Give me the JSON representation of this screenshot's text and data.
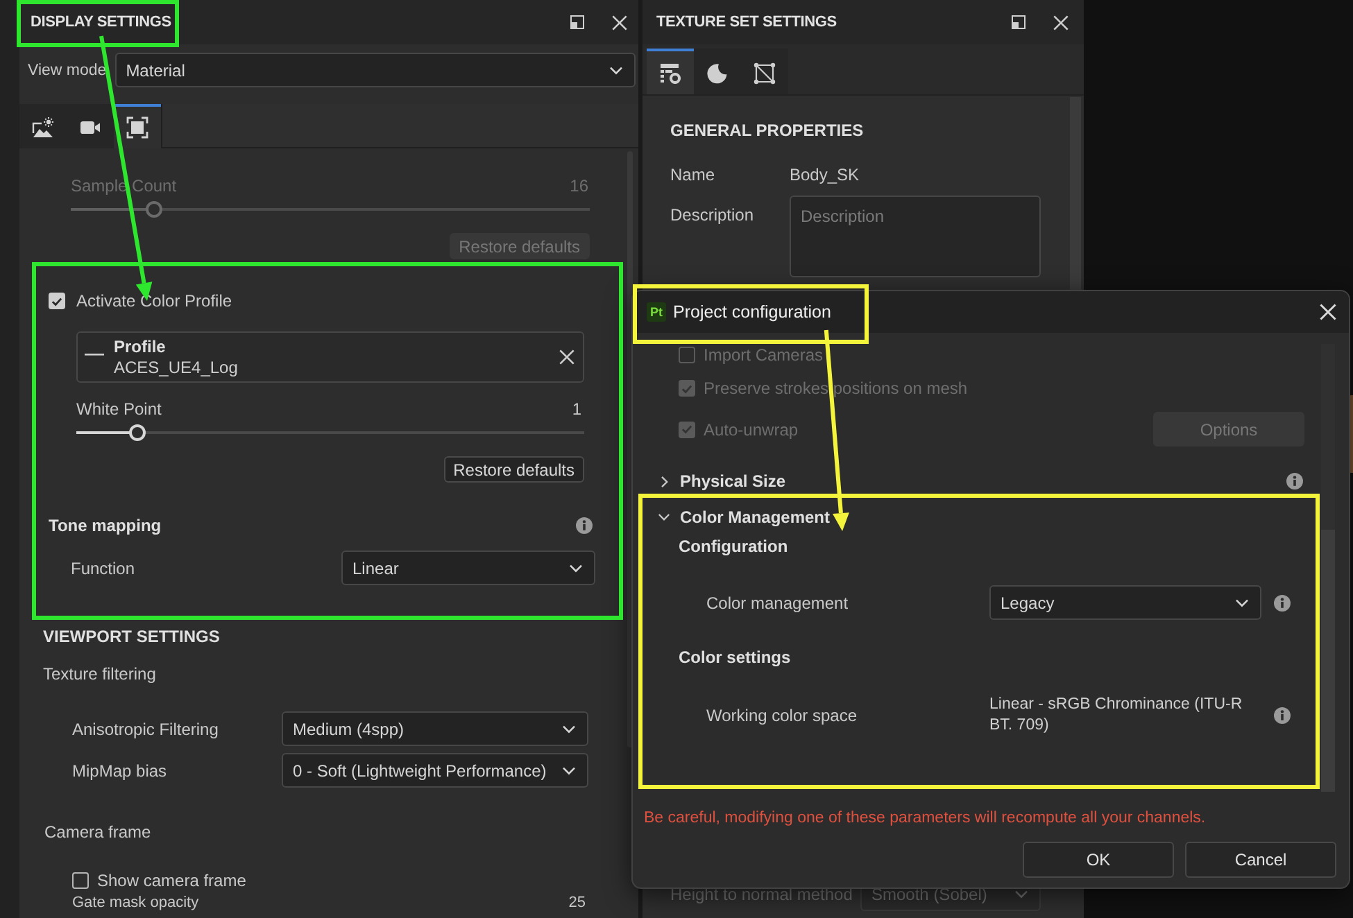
{
  "display_settings": {
    "title": "DISPLAY SETTINGS",
    "view_mode": {
      "label": "View mode",
      "value": "Material"
    },
    "tabs": [
      {
        "kind": "environment",
        "selected": false
      },
      {
        "kind": "camera",
        "selected": false
      },
      {
        "kind": "display",
        "selected": true
      }
    ],
    "sample_count": {
      "label": "Sample Count",
      "reading": "16",
      "level": 0.16,
      "disabled": true
    },
    "sample_restore": {
      "label": "Restore defaults",
      "disabled": true
    },
    "color_profile": {
      "label": "Activate Color Profile",
      "checked": true
    },
    "profile": {
      "title": "Profile",
      "value": "ACES_UE4_Log"
    },
    "white_point": {
      "label": "White Point",
      "reading": "1",
      "level": 0.12
    },
    "white_point_restore": {
      "label": "Restore defaults",
      "disabled": false
    },
    "tone_mapping": {
      "title": "Tone mapping",
      "function": {
        "label": "Function",
        "value": "Linear"
      }
    }
  },
  "viewport_settings": {
    "title": "VIEWPORT SETTINGS",
    "texture_filtering": {
      "title": "Texture filtering",
      "fields": [
        {
          "label": "Anisotropic Filtering",
          "value": "Medium (4spp)"
        },
        {
          "label": "MipMap bias",
          "value": "0 - Soft (Lightweight Performance)"
        }
      ]
    },
    "camera_frame": {
      "title": "Camera frame",
      "show_frame": {
        "label": "Show camera frame",
        "checked": false
      },
      "gate_mask_opacity": {
        "label": "Gate mask opacity",
        "reading": "25"
      }
    }
  },
  "texture_set_settings": {
    "title": "TEXTURE SET SETTINGS",
    "tabs": [
      {
        "kind": "properties",
        "selected": true
      },
      {
        "kind": "material",
        "selected": false
      },
      {
        "kind": "uv",
        "selected": false
      }
    ],
    "section_title": "GENERAL PROPERTIES",
    "name": {
      "label": "Name",
      "value": "Body_SK"
    },
    "description": {
      "label": "Description",
      "placeholder": "Description"
    },
    "height_to_normal": {
      "label": "Height to normal method",
      "value": "Smooth (Sobel)",
      "disabled": true
    }
  },
  "project_configuration": {
    "logo": "Pt",
    "title": "Project configuration",
    "options": [
      {
        "label": "Import Cameras",
        "checked": false,
        "disabled": true
      },
      {
        "label": "Preserve strokes positions on mesh",
        "checked": true,
        "disabled": true
      },
      {
        "label": "Auto-unwrap",
        "checked": true,
        "disabled": true
      }
    ],
    "options_button": {
      "label": "Options",
      "disabled": true
    },
    "sections": [
      {
        "title": "Physical Size",
        "expanded": false,
        "info": true
      },
      {
        "title": "Color Management",
        "expanded": true,
        "info": false,
        "groups": [
          {
            "title": "Configuration",
            "fields": [
              {
                "kind": "dropdown",
                "label": "Color management",
                "value": "Legacy"
              }
            ]
          },
          {
            "title": "Color settings",
            "fields": [
              {
                "kind": "text",
                "label": "Working color space",
                "value": "Linear - sRGB Chrominance (ITU-R BT. 709)"
              }
            ]
          }
        ]
      }
    ],
    "warning": "Be careful, modifying one of these parameters will recompute all your channels.",
    "buttons": [
      {
        "label": "OK"
      },
      {
        "label": "Cancel"
      }
    ]
  },
  "annotations": [
    {
      "kind": "box",
      "color": "#2ee62e"
    },
    {
      "kind": "arrow",
      "color": "#2ee62e"
    },
    {
      "kind": "box",
      "color": "#2ee62e"
    },
    {
      "kind": "box",
      "color": "#f4f43c"
    },
    {
      "kind": "arrow",
      "color": "#f4f43c"
    },
    {
      "kind": "box",
      "color": "#f4f43c"
    }
  ]
}
